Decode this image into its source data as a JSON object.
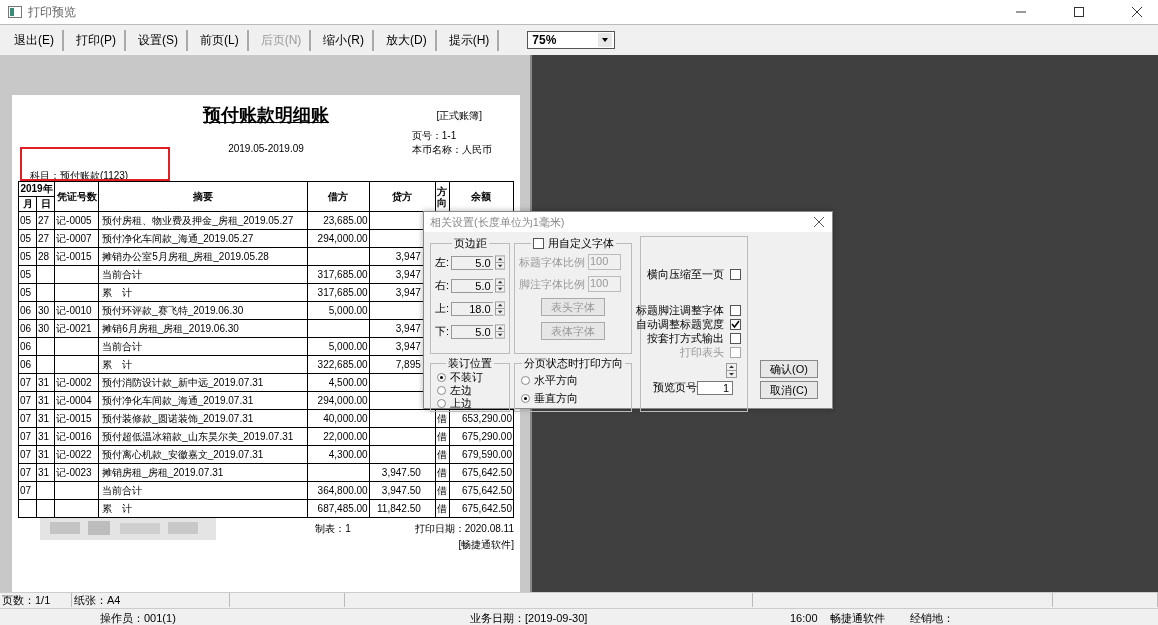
{
  "window": {
    "title": "打印预览"
  },
  "toolbar": {
    "buttons": [
      {
        "label": "退出(E)",
        "disabled": false
      },
      {
        "label": "打印(P)",
        "disabled": false
      },
      {
        "label": "设置(S)",
        "disabled": false
      },
      {
        "label": "前页(L)",
        "disabled": false
      },
      {
        "label": "后页(N)",
        "disabled": true
      },
      {
        "label": "缩小(R)",
        "disabled": false
      },
      {
        "label": "放大(D)",
        "disabled": false
      },
      {
        "label": "提示(H)",
        "disabled": false
      }
    ],
    "zoom": "75%"
  },
  "document": {
    "title": "预付账款明细账",
    "tag": "[正式账簿]",
    "period": "2019.05-2019.09",
    "page_no": "页号：1-1",
    "currency": "本币名称：人民币",
    "subject": "科目：预付账款(1123)",
    "columns": {
      "year": "2019年",
      "month": "月",
      "day": "日",
      "voucher": "凭证号数",
      "summary": "摘要",
      "debit": "借方",
      "credit": "贷方",
      "direction": "方向",
      "balance": "余额"
    },
    "rows": [
      {
        "month": "05",
        "day": "27",
        "voucher": "记-0005",
        "summary": "预付房租、物业费及押金_房租_2019.05.27",
        "debit": "23,685.00"
      },
      {
        "month": "05",
        "day": "27",
        "voucher": "记-0007",
        "summary": "预付净化车间款_海通_2019.05.27",
        "debit": "294,000.00"
      },
      {
        "month": "05",
        "day": "28",
        "voucher": "记-0015",
        "summary": "摊销办公室5月房租_房租_2019.05.28",
        "credit": "3,947"
      },
      {
        "month": "05",
        "summary": "当前合计",
        "debit": "317,685.00",
        "credit": "3,947"
      },
      {
        "month": "05",
        "summary": "累　计",
        "debit": "317,685.00",
        "credit": "3,947"
      },
      {
        "month": "06",
        "day": "30",
        "voucher": "记-0010",
        "summary": "预付环评款_赛飞特_2019.06.30",
        "debit": "5,000.00"
      },
      {
        "month": "06",
        "day": "30",
        "voucher": "记-0021",
        "summary": "摊销6月房租_房租_2019.06.30",
        "credit": "3,947"
      },
      {
        "month": "06",
        "summary": "当前合计",
        "debit": "5,000.00",
        "credit": "3,947"
      },
      {
        "month": "06",
        "summary": "累　计",
        "debit": "322,685.00",
        "credit": "7,895"
      },
      {
        "month": "07",
        "day": "31",
        "voucher": "记-0002",
        "summary": "预付消防设计款_新中远_2019.07.31",
        "debit": "4,500.00"
      },
      {
        "month": "07",
        "day": "31",
        "voucher": "记-0004",
        "summary": "预付净化车间款_海通_2019.07.31",
        "debit": "294,000.00"
      },
      {
        "month": "07",
        "day": "31",
        "voucher": "记-0015",
        "summary": "预付装修款_圆诺装饰_2019.07.31",
        "debit": "40,000.00",
        "direction": "借",
        "balance": "653,290.00"
      },
      {
        "month": "07",
        "day": "31",
        "voucher": "记-0016",
        "summary": "预付超低温冰箱款_山东昊尔美_2019.07.31",
        "debit": "22,000.00",
        "direction": "借",
        "balance": "675,290.00"
      },
      {
        "month": "07",
        "day": "31",
        "voucher": "记-0022",
        "summary": "预付离心机款_安徽嘉文_2019.07.31",
        "debit": "4,300.00",
        "direction": "借",
        "balance": "679,590.00"
      },
      {
        "month": "07",
        "day": "31",
        "voucher": "记-0023",
        "summary": "摊销房租_房租_2019.07.31",
        "credit": "3,947.50",
        "direction": "借",
        "balance": "675,642.50"
      },
      {
        "month": "07",
        "summary": "当前合计",
        "debit": "364,800.00",
        "credit": "3,947.50",
        "direction": "借",
        "balance": "675,642.50"
      },
      {
        "summary": "累　计",
        "debit": "687,485.00",
        "credit": "11,842.50",
        "direction": "借",
        "balance": "675,642.50"
      }
    ],
    "maker": "制表：1",
    "print_date": "打印日期：2020.08.11",
    "software": "[畅捷通软件]"
  },
  "dialog": {
    "title": "相关设置(长度单位为1毫米)",
    "margins": {
      "label": "页边距",
      "fields": [
        {
          "label": "左:",
          "value": "5.0"
        },
        {
          "label": "右:",
          "value": "5.0"
        },
        {
          "label": "上:",
          "value": "18.0"
        },
        {
          "label": "下:",
          "value": "5.0"
        }
      ]
    },
    "custom_font": {
      "label": "用自定义字体",
      "checked": false,
      "title_ratio_label": "标题字体比例",
      "title_ratio": "100",
      "footer_ratio_label": "脚注字体比例",
      "footer_ratio": "100",
      "buttons": [
        "表头字体",
        "表体字体"
      ]
    },
    "binding": {
      "label": "装订位置",
      "options": [
        {
          "label": "不装订",
          "selected": true
        },
        {
          "label": "左边",
          "selected": false
        },
        {
          "label": "上边",
          "selected": false
        }
      ]
    },
    "direction": {
      "label": "分页状态时打印方向",
      "options": [
        {
          "label": "水平方向",
          "selected": false
        },
        {
          "label": "垂直方向",
          "selected": true
        }
      ]
    },
    "options": [
      {
        "label": "横向压缩至一页",
        "checked": false,
        "disabled": false
      },
      {
        "label": "标题脚注调整字体",
        "checked": false,
        "disabled": false
      },
      {
        "label": "自动调整标题宽度",
        "checked": true,
        "disabled": false
      },
      {
        "label": "按套打方式输出",
        "checked": false,
        "disabled": false
      },
      {
        "label": "打印表头",
        "checked": false,
        "disabled": true
      }
    ],
    "preview_page_label": "预览页号",
    "preview_page": "1",
    "buttons": [
      "确认(O)",
      "取消(C)"
    ]
  },
  "status_bar": {
    "pages": "页数：1/1",
    "paper": "纸张：A4"
  },
  "status_bar_2": [
    "操作员：001(1)",
    "业务日期：[2019-09-30]",
    "16:00",
    "畅捷通软件",
    "经销地："
  ]
}
